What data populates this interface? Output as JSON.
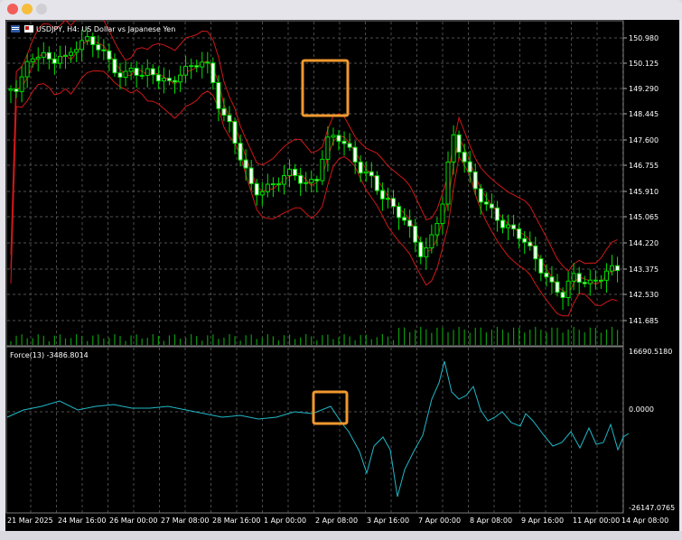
{
  "window": {
    "title": ""
  },
  "chart": {
    "title": "USDJPY, H4:  US Dollar vs Japanese Yen",
    "price_ticks": [
      "150.980",
      "150.125",
      "149.290",
      "148.445",
      "147.600",
      "146.755",
      "145.910",
      "145.065",
      "144.220",
      "143.375",
      "142.530",
      "141.685"
    ],
    "time_ticks": [
      "21 Mar 2025",
      "24 Mar 16:00",
      "26 Mar 00:00",
      "27 Mar 08:00",
      "28 Mar 16:00",
      "1 Apr 00:00",
      "2 Apr 08:00",
      "3 Apr 16:00",
      "7 Apr 00:00",
      "8 Apr 08:00",
      "9 Apr 16:00",
      "11 Apr 00:00",
      "14 Apr 08:00"
    ]
  },
  "indicator": {
    "label": "Force(13) -3486.8014",
    "ticks": [
      "16690.5180",
      "0.0000",
      "-26147.0765"
    ]
  },
  "colors": {
    "candle": "#00e000",
    "band": "#d01818",
    "force": "#20b8c8",
    "grid": "#6a6a6a",
    "highlight": "#f0982e"
  }
}
